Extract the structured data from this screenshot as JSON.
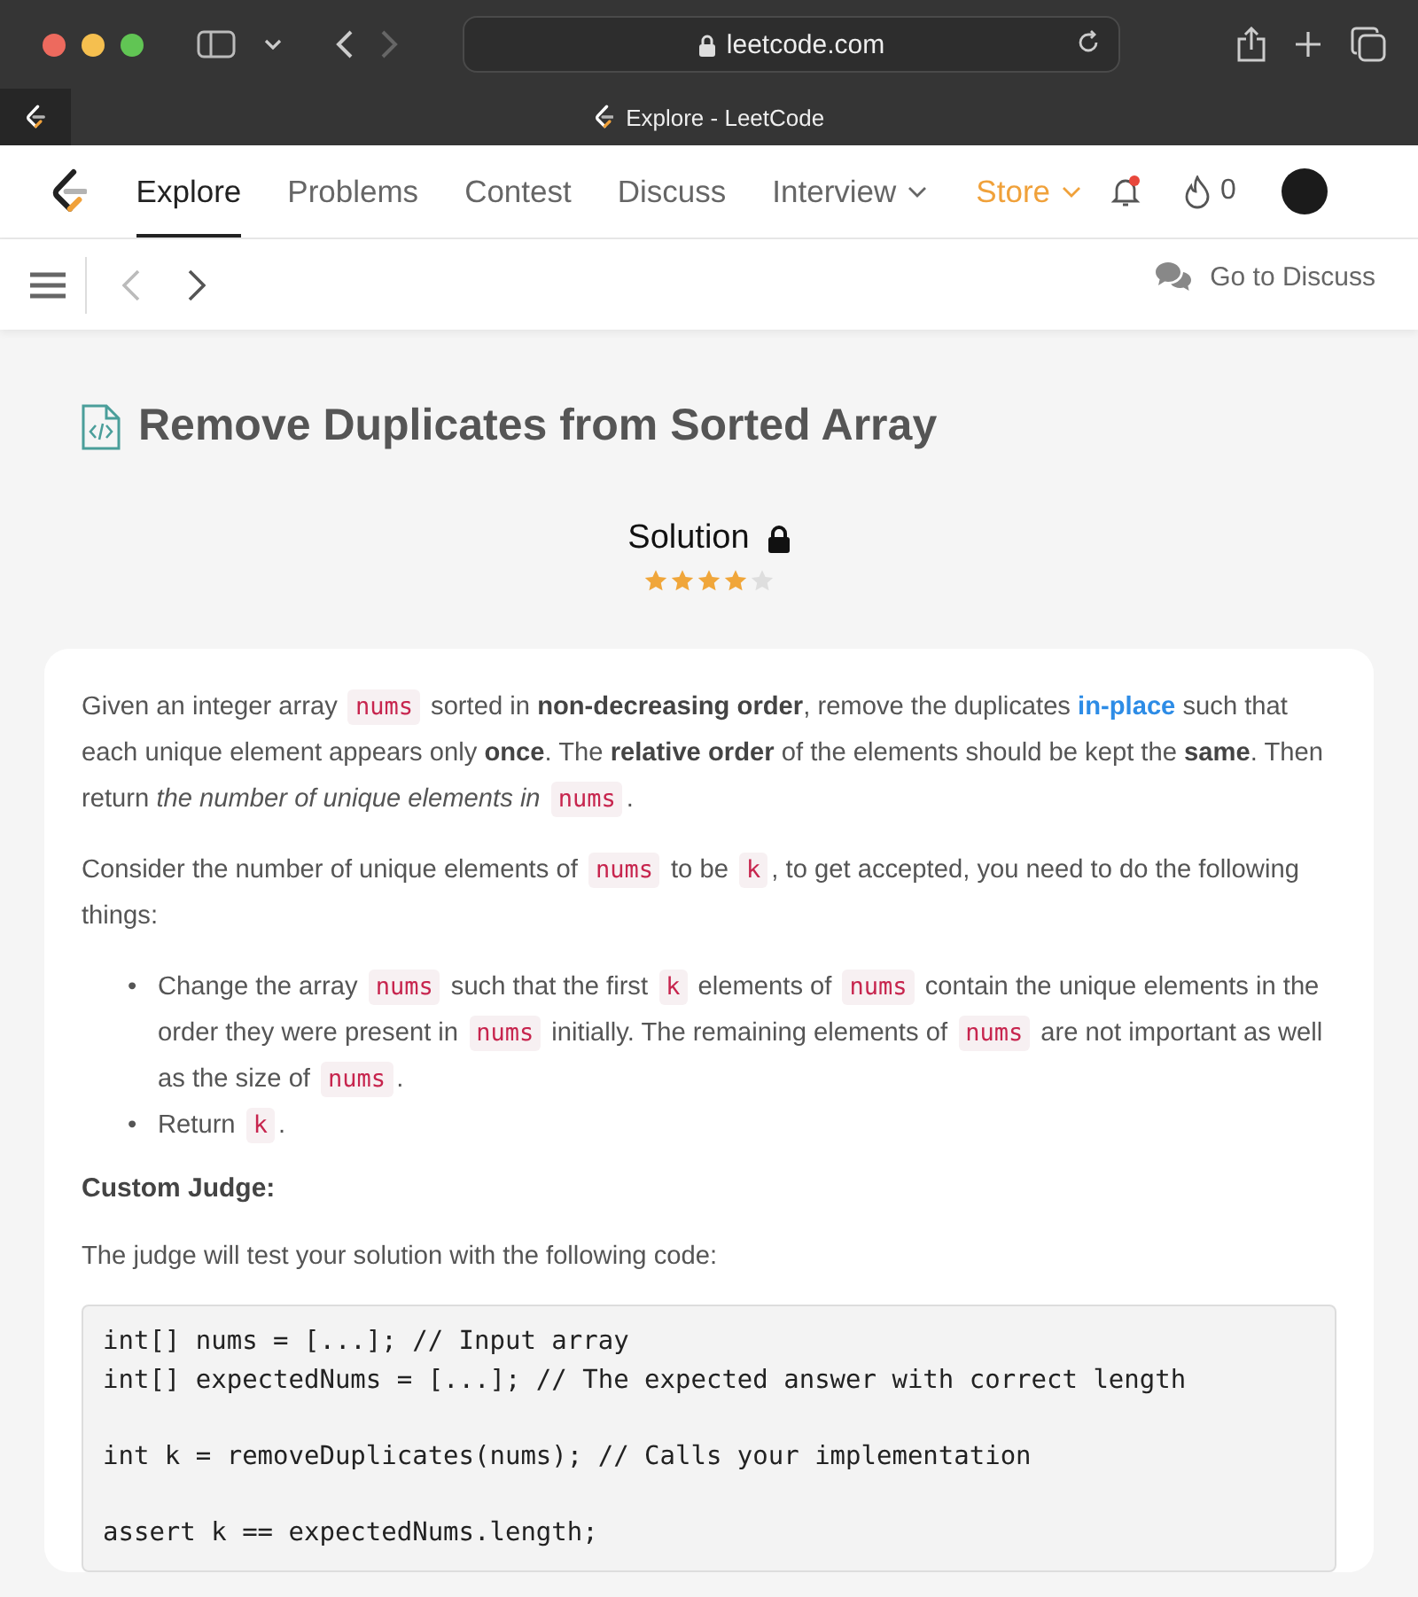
{
  "browser": {
    "url": "leetcode.com",
    "tab_title": "Explore - LeetCode"
  },
  "nav": {
    "items": [
      {
        "label": "Explore",
        "kind": "link",
        "selected": true,
        "has_menu": false
      },
      {
        "label": "Problems",
        "kind": "link",
        "selected": false,
        "has_menu": false
      },
      {
        "label": "Contest",
        "kind": "link",
        "selected": false,
        "has_menu": false
      },
      {
        "label": "Discuss",
        "kind": "link",
        "selected": false,
        "has_menu": false
      },
      {
        "label": "Interview",
        "kind": "link",
        "selected": false,
        "has_menu": true
      },
      {
        "label": "Store",
        "kind": "store",
        "selected": false,
        "has_menu": true
      }
    ],
    "notification": true,
    "streak": "0"
  },
  "toolbar": {
    "discuss_label": "Go to Discuss"
  },
  "article": {
    "title": "Remove Duplicates from Sorted Array",
    "solution_label": "Solution",
    "locked": true,
    "stars": 4,
    "blocks": [
      {
        "kind": "paragraph",
        "segments": [
          {
            "kind": "text",
            "text": "Given an integer array "
          },
          {
            "kind": "code",
            "text": "nums"
          },
          {
            "kind": "text",
            "text": " sorted in "
          },
          {
            "kind": "bold",
            "text": "non-decreasing order"
          },
          {
            "kind": "text",
            "text": ", remove the duplicates "
          },
          {
            "kind": "link",
            "text": "in-place"
          },
          {
            "kind": "text",
            "text": " such that each unique element appears only "
          },
          {
            "kind": "bold",
            "text": "once"
          },
          {
            "kind": "text",
            "text": ". The "
          },
          {
            "kind": "bold",
            "text": "relative order"
          },
          {
            "kind": "text",
            "text": " of the elements should be kept the "
          },
          {
            "kind": "bold",
            "text": "same"
          },
          {
            "kind": "text",
            "text": ". Then return "
          },
          {
            "kind": "italic",
            "text": "the number of unique elements in "
          },
          {
            "kind": "code",
            "text": "nums"
          },
          {
            "kind": "text",
            "text": "."
          }
        ]
      },
      {
        "kind": "paragraph",
        "segments": [
          {
            "kind": "text",
            "text": "Consider the number of unique elements of "
          },
          {
            "kind": "code",
            "text": "nums"
          },
          {
            "kind": "text",
            "text": " to be "
          },
          {
            "kind": "code",
            "text": "k"
          },
          {
            "kind": "text",
            "text": ", to get accepted, you need to do the following things:"
          }
        ]
      },
      {
        "kind": "list",
        "items": [
          {
            "marker": "•",
            "segments": [
              {
                "kind": "text",
                "text": "Change the array "
              },
              {
                "kind": "code",
                "text": "nums"
              },
              {
                "kind": "text",
                "text": " such that the first "
              },
              {
                "kind": "code",
                "text": "k"
              },
              {
                "kind": "text",
                "text": " elements of "
              },
              {
                "kind": "code",
                "text": "nums"
              },
              {
                "kind": "text",
                "text": " contain the unique elements in the order they were present in "
              },
              {
                "kind": "code",
                "text": "nums"
              },
              {
                "kind": "text",
                "text": " initially. The remaining elements of "
              },
              {
                "kind": "code",
                "text": "nums"
              },
              {
                "kind": "text",
                "text": " are not important as well as the size of "
              },
              {
                "kind": "code",
                "text": "nums"
              },
              {
                "kind": "text",
                "text": "."
              }
            ]
          },
          {
            "marker": "•",
            "segments": [
              {
                "kind": "text",
                "text": "Return "
              },
              {
                "kind": "code",
                "text": "k"
              },
              {
                "kind": "text",
                "text": "."
              }
            ]
          }
        ]
      },
      {
        "kind": "heading",
        "text": "Custom Judge:"
      },
      {
        "kind": "paragraph",
        "segments": [
          {
            "kind": "text",
            "text": "The judge will test your solution with the following code:"
          }
        ]
      },
      {
        "kind": "code",
        "groups": [
          [
            "int[] nums = [...]; // Input array",
            "int[] expectedNums = [...]; // The expected answer with correct length"
          ],
          [
            "int k = removeDuplicates(nums); // Calls your implementation"
          ],
          [
            "assert k == expectedNums.length;"
          ]
        ]
      }
    ]
  }
}
